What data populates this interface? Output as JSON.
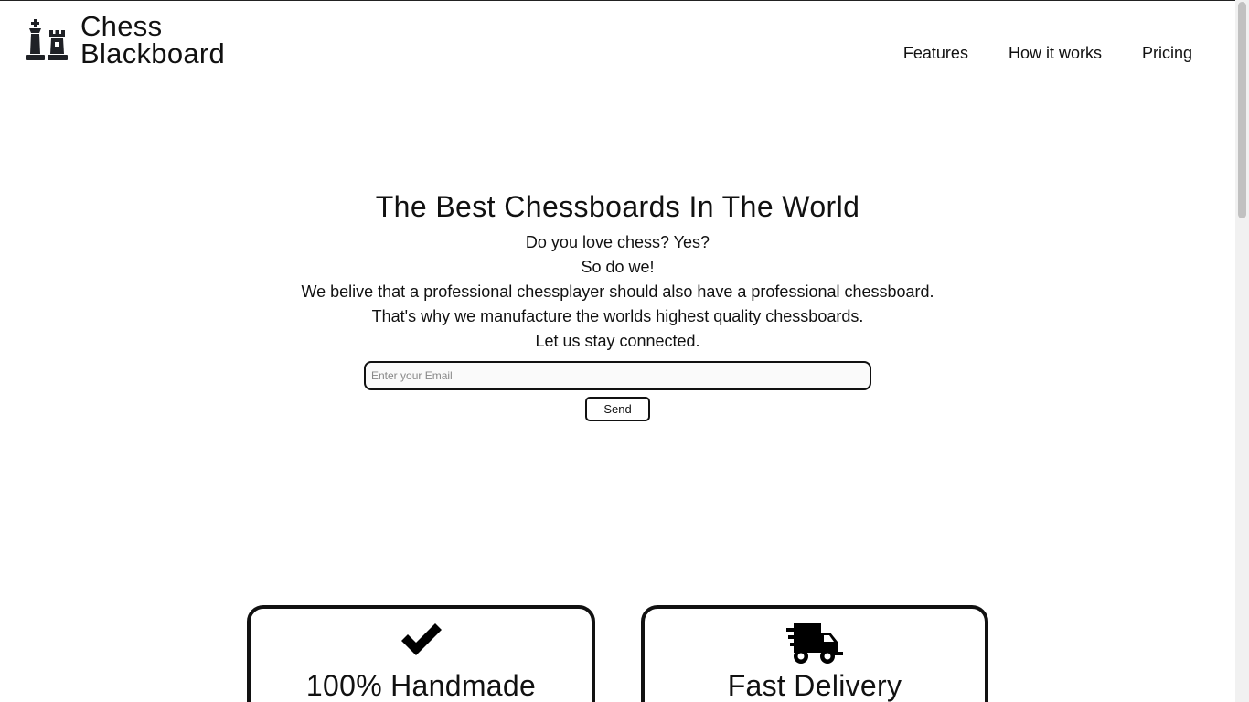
{
  "brand": {
    "line1": "Chess",
    "line2": "Blackboard",
    "icon": "chess-pieces-icon"
  },
  "nav": {
    "items": [
      {
        "label": "Features"
      },
      {
        "label": "How it works"
      },
      {
        "label": "Pricing"
      }
    ]
  },
  "hero": {
    "title": "The Best Chessboards In The World",
    "lines": [
      "Do you love chess? Yes?",
      "So do we!",
      "We belive that a professional chessplayer should also have a professional chessboard.",
      "That's why we manufacture the worlds highest quality chessboards.",
      "Let us stay connected."
    ],
    "email_placeholder": "Enter your Email",
    "email_value": "",
    "send_label": "Send"
  },
  "features": [
    {
      "icon": "checkmark-icon",
      "title": "100% Handmade"
    },
    {
      "icon": "delivery-truck-icon",
      "title": "Fast Delivery"
    }
  ],
  "colors": {
    "text": "#111111",
    "background": "#ffffff",
    "border": "#111111"
  }
}
